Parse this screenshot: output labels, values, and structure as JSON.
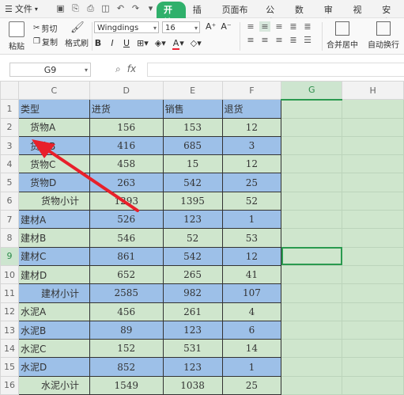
{
  "menu": {
    "file_label": "文件",
    "tabs": [
      "开始",
      "插入",
      "页面布局",
      "公式",
      "数据",
      "审阅",
      "视图",
      "安全"
    ],
    "active_tab": "开始"
  },
  "ribbon": {
    "paste_label": "粘贴",
    "cut_label": "剪切",
    "copy_label": "复制",
    "format_painter_label": "格式刷",
    "font_name": "Wingdings",
    "font_size": "16",
    "merge_label": "合并居中",
    "wrap_label": "自动换行",
    "accent_color": "#2fb06b"
  },
  "formula_bar": {
    "name_box": "G9",
    "formula": ""
  },
  "sheet": {
    "columns": [
      "C",
      "D",
      "E",
      "F",
      "G",
      "H"
    ],
    "selected_column": "G",
    "selected_row": "9",
    "row_numbers": [
      "1",
      "2",
      "3",
      "4",
      "5",
      "6",
      "7",
      "8",
      "9",
      "10",
      "11",
      "12",
      "13",
      "14",
      "15",
      "16"
    ],
    "rows": [
      {
        "c": "类型",
        "d": "进货",
        "e": "销售",
        "f": "退货",
        "style": "blue",
        "indent": 0,
        "header": true
      },
      {
        "c": "货物A",
        "d": "156",
        "e": "153",
        "f": "12",
        "style": "green",
        "indent": 1
      },
      {
        "c": "货物B",
        "d": "416",
        "e": "685",
        "f": "3",
        "style": "blue",
        "indent": 1
      },
      {
        "c": "货物C",
        "d": "458",
        "e": "15",
        "f": "12",
        "style": "green",
        "indent": 1
      },
      {
        "c": "货物D",
        "d": "263",
        "e": "542",
        "f": "25",
        "style": "blue",
        "indent": 1
      },
      {
        "c": "货物小计",
        "d": "1293",
        "e": "1395",
        "f": "52",
        "style": "green",
        "indent": 2
      },
      {
        "c": "建材A",
        "d": "526",
        "e": "123",
        "f": "1",
        "style": "blue",
        "indent": 0
      },
      {
        "c": "建材B",
        "d": "546",
        "e": "52",
        "f": "53",
        "style": "green",
        "indent": 0
      },
      {
        "c": "建材C",
        "d": "861",
        "e": "542",
        "f": "12",
        "style": "blue",
        "indent": 0
      },
      {
        "c": "建材D",
        "d": "652",
        "e": "265",
        "f": "41",
        "style": "green",
        "indent": 0
      },
      {
        "c": "建材小计",
        "d": "2585",
        "e": "982",
        "f": "107",
        "style": "blue",
        "indent": 2
      },
      {
        "c": "水泥A",
        "d": "456",
        "e": "261",
        "f": "4",
        "style": "green",
        "indent": 0
      },
      {
        "c": "水泥B",
        "d": "89",
        "e": "123",
        "f": "6",
        "style": "blue",
        "indent": 0
      },
      {
        "c": "水泥C",
        "d": "152",
        "e": "531",
        "f": "14",
        "style": "green",
        "indent": 0
      },
      {
        "c": "水泥D",
        "d": "852",
        "e": "123",
        "f": "1",
        "style": "blue",
        "indent": 0
      },
      {
        "c": "水泥小计",
        "d": "1549",
        "e": "1038",
        "f": "25",
        "style": "green",
        "indent": 2
      }
    ],
    "colors": {
      "blue_row": "#9dc0e8",
      "green_row": "#cfe6cd",
      "annotation_arrow": "#e8202a"
    }
  }
}
